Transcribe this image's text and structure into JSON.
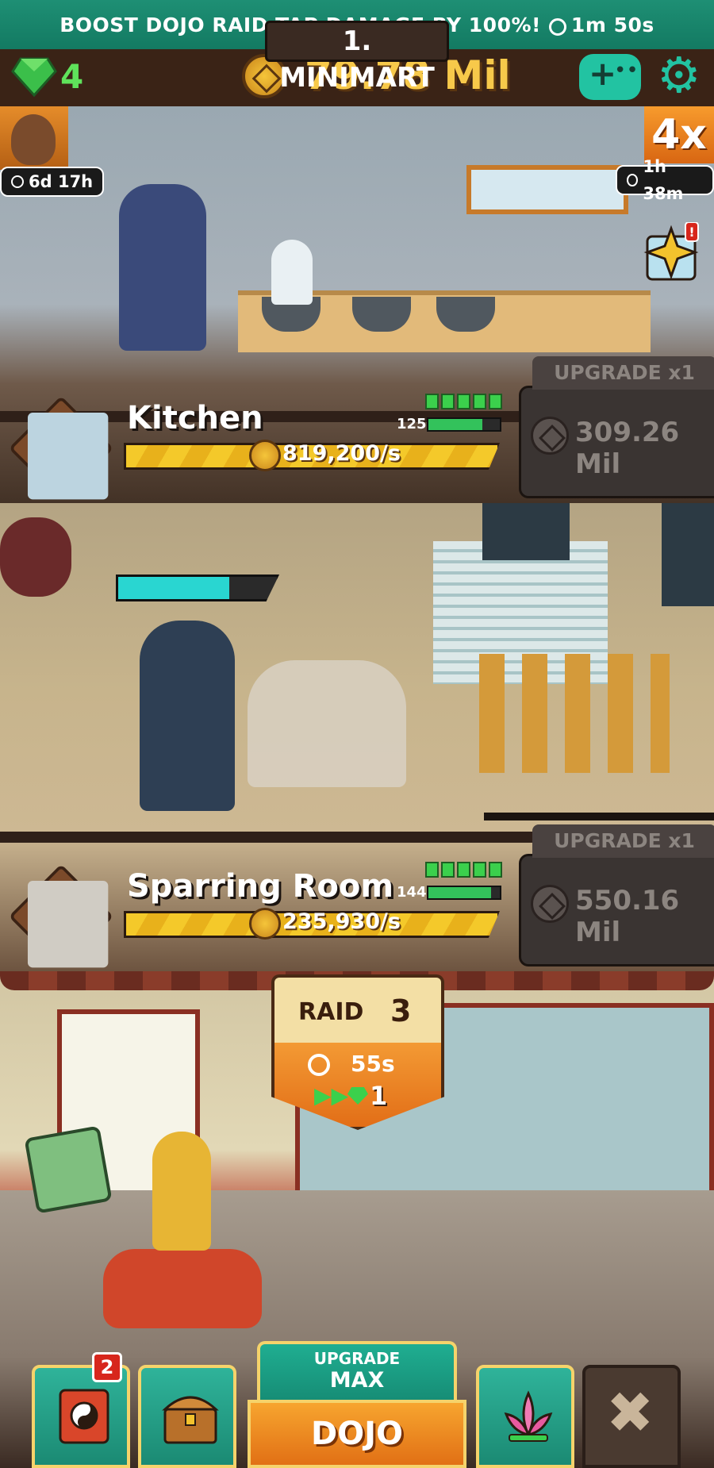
{
  "banner": {
    "text": "BOOST DOJO RAID TAP DAMAGE BY 100%!",
    "timer": "1m 50s"
  },
  "topbar": {
    "gems": "4",
    "gold": "79.78 Mil"
  },
  "floor1": {
    "title": "1. MINIMART",
    "left_timer": "6d 17h",
    "right_timer": "1h 38m",
    "multiplier": "4x"
  },
  "rooms": [
    {
      "name": "Kitchen",
      "rate": "819,200/s",
      "level": "125",
      "level_fill": 0.75,
      "upgrade_label": "UPGRADE x1",
      "upgrade_cost": "309.26 Mil"
    },
    {
      "name": "Sparring Room",
      "rate": "235,930/s",
      "level": "144",
      "level_fill": 0.88,
      "upgrade_label": "UPGRADE x1",
      "upgrade_cost": "550.16 Mil"
    }
  ],
  "sparring": {
    "hp_fill": 0.7
  },
  "raid": {
    "label": "RAID",
    "number": "3",
    "time": "55s",
    "skip_cost": "1"
  },
  "bottom_nav": {
    "scroll_badge": "2",
    "dojo_upgrade_line1": "UPGRADE",
    "dojo_upgrade_line2": "MAX",
    "dojo_label": "DOJO"
  },
  "colors": {
    "accent_teal": "#22c3a2",
    "gold": "#f7c94a",
    "gem_green": "#5fe25b",
    "orange": "#e17015"
  }
}
